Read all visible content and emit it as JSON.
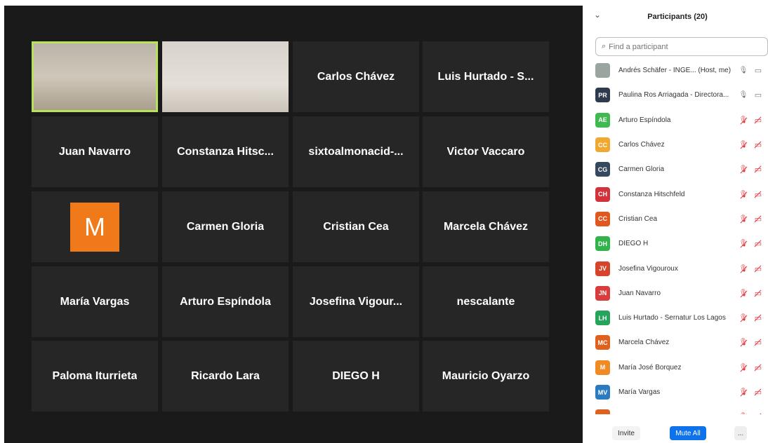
{
  "gallery": {
    "tiles": [
      [
        "",
        "",
        "Carlos Chávez",
        "Luis Hurtado - S..."
      ],
      [
        "Juan Navarro",
        "Constanza Hitsc...",
        "sixtoalmonacid-...",
        "Victor Vaccaro"
      ],
      [
        "",
        "Carmen Gloria",
        "Cristian Cea",
        "Marcela Chávez"
      ],
      [
        "María Vargas",
        "Arturo Espíndola",
        "Josefina Vigour...",
        "nescalante"
      ],
      [
        "Paloma Iturrieta",
        "Ricardo Lara",
        "DIEGO H",
        "Mauricio Oyarzo"
      ]
    ],
    "avatar_letter": "M",
    "active_color": "#b9e25c"
  },
  "panel": {
    "collapse_icon": "chevron-down-icon",
    "title": "Participants (20)",
    "search_placeholder": "Find a participant",
    "participants": [
      {
        "initials": "",
        "color": "#9aa5a0",
        "name": "Andrés Schäfer - INGE...  (Host, me)",
        "mic": "on",
        "cam": "on"
      },
      {
        "initials": "PR",
        "color": "#2e3b4e",
        "name": "Paulina Ros Arriagada - Directora...",
        "mic": "on",
        "cam": "on"
      },
      {
        "initials": "AE",
        "color": "#3fb950",
        "name": "Arturo Espíndola",
        "mic": "muted",
        "cam": "muted"
      },
      {
        "initials": "CC",
        "color": "#f0a830",
        "name": "Carlos Chávez",
        "mic": "muted",
        "cam": "muted"
      },
      {
        "initials": "CG",
        "color": "#35485d",
        "name": "Carmen Gloria",
        "mic": "muted",
        "cam": "muted"
      },
      {
        "initials": "CH",
        "color": "#d2323a",
        "name": "Constanza Hitschfeld",
        "mic": "muted",
        "cam": "muted"
      },
      {
        "initials": "CC",
        "color": "#e2571e",
        "name": "Cristian Cea",
        "mic": "muted",
        "cam": "muted"
      },
      {
        "initials": "DH",
        "color": "#2fb34a",
        "name": "DIEGO H",
        "mic": "muted",
        "cam": "muted"
      },
      {
        "initials": "JV",
        "color": "#d6452a",
        "name": "Josefina Vigouroux",
        "mic": "muted",
        "cam": "muted"
      },
      {
        "initials": "JN",
        "color": "#d93c3c",
        "name": "Juan Navarro",
        "mic": "muted",
        "cam": "muted"
      },
      {
        "initials": "LH",
        "color": "#25a55a",
        "name": "Luis Hurtado - Sernatur Los Lagos",
        "mic": "muted",
        "cam": "muted"
      },
      {
        "initials": "MC",
        "color": "#e0601e",
        "name": "Marcela Chávez",
        "mic": "muted",
        "cam": "muted"
      },
      {
        "initials": "M",
        "color": "#f08a24",
        "name": "María José Borquez",
        "mic": "muted",
        "cam": "muted"
      },
      {
        "initials": "MV",
        "color": "#2a7bc0",
        "name": "María Vargas",
        "mic": "muted",
        "cam": "muted"
      },
      {
        "initials": "",
        "color": "#e0601e",
        "name": "",
        "mic": "muted",
        "cam": "muted"
      }
    ],
    "footer": {
      "invite": "Invite",
      "mute_all": "Mute All",
      "more": "..."
    }
  }
}
